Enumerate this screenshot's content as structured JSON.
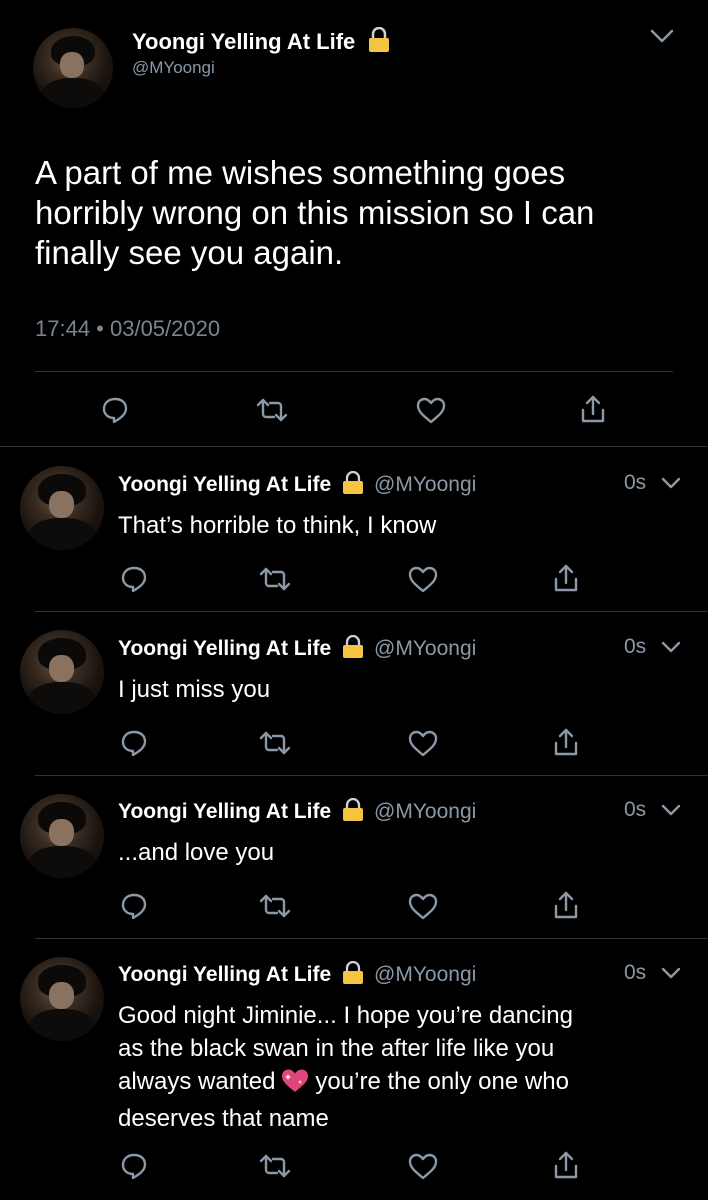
{
  "main_tweet": {
    "name": "Yoongi Yelling At Life",
    "handle": "@MYoongi",
    "text": "A part of me wishes something goes horribly wrong on this mission so I can finally see you again.",
    "timestamp": "17:44 • 03/05/2020",
    "icons": [
      "reply-icon",
      "retweet-icon",
      "like-icon",
      "share-icon"
    ]
  },
  "replies": [
    {
      "name": "Yoongi Yelling At Life",
      "handle": "@MYoongi",
      "time": "0s",
      "text": "That’s horrible to think, I know"
    },
    {
      "name": "Yoongi Yelling At Life",
      "handle": "@MYoongi",
      "time": "0s",
      "text": "I just miss you"
    },
    {
      "name": "Yoongi Yelling At Life",
      "handle": "@MYoongi",
      "time": "0s",
      "text": "...and love you"
    },
    {
      "name": "Yoongi Yelling At Life",
      "handle": "@MYoongi",
      "time": "0s",
      "text_line1": "Good night Jiminie... I hope you’re dancing",
      "text_line2": "as the black swan in the after life like you",
      "text_line3_before_emoji": "always wanted",
      "text_line3_after_emoji": "you’re the only one who",
      "text_line4": "deserves that name"
    }
  ],
  "colors": {
    "background": "#000000",
    "text": "#ffffff",
    "secondary": "#8b98a5",
    "divider": "#2f3336",
    "lock": "#f5c542",
    "emoji": "#e0457b"
  }
}
